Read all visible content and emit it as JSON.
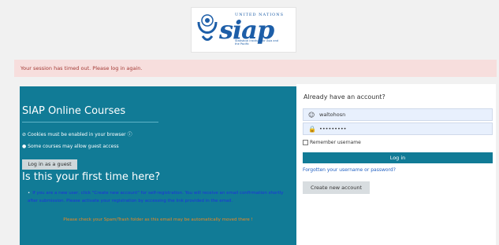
{
  "logo": {
    "org": "UNITED NATIONS",
    "word": "siap",
    "subtitle": "Statistical Institute for Asia and the Pacific"
  },
  "alert": {
    "text": "Your session has timed out. Please log in again."
  },
  "left": {
    "title": "SIAP Online Courses",
    "cookies": "Cookies must be enabled in your browser",
    "guest_access": "Some courses may allow guest access",
    "guest_button": "Log in as a guest",
    "first_time_title": "Is this your first time here?",
    "info": "If you are a new user, click \"Create new account\" for self-registration. You will receive an email confirmation shortly after submission. Please activate your registration by accessing the link provided in the email.",
    "warning": "Please check your Spam/Trash folder as this email may be automatically moved there !"
  },
  "right": {
    "title": "Already have an account?",
    "username_value": "waltohosn",
    "password_value": "•••••••••",
    "remember": "Remember username",
    "login_button": "Log in",
    "forgot": "Forgotten your username or password?",
    "create_button": "Create new account"
  },
  "colors": {
    "teal": "#117b96",
    "alert_bg": "#f7dedd",
    "alert_text": "#a33a35",
    "warning": "#f0891f",
    "info_text": "#1f2fe0"
  },
  "icons": [
    "un-emblem-icon",
    "user-icon",
    "lock-icon",
    "check-circle-icon",
    "info-circle-icon"
  ]
}
